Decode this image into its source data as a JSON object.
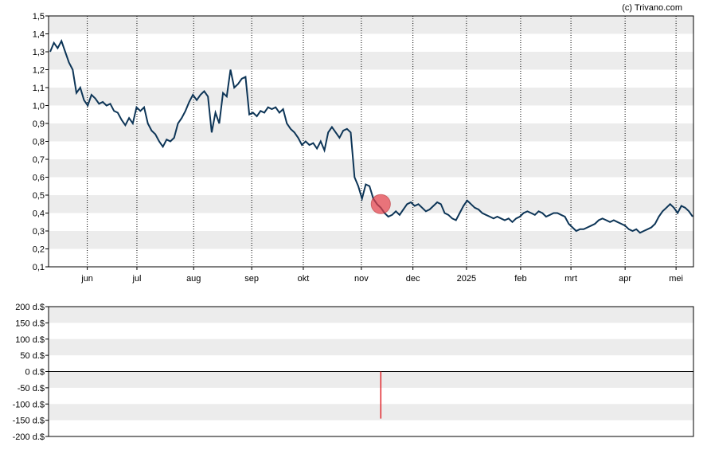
{
  "copyright": "(c) Trivano.com",
  "colors": {
    "price_line": "#0d3557",
    "band": "#ececec",
    "marker": "#e8414a",
    "bar": "#e0242b"
  },
  "chart_data": [
    {
      "type": "line",
      "ylim": [
        0.1,
        1.5
      ],
      "yticks": [
        "0,1",
        "0,2",
        "0,3",
        "0,4",
        "0,5",
        "0,6",
        "0,7",
        "0,8",
        "0,9",
        "1,0",
        "1,1",
        "1,2",
        "1,3",
        "1,4",
        "1,5"
      ],
      "xticks": [
        "jun",
        "jul",
        "aug",
        "sep",
        "okt",
        "nov",
        "dec",
        "2025",
        "feb",
        "mrt",
        "apr",
        "mei"
      ],
      "grid": true,
      "series": [
        {
          "values": [
            1.3,
            1.35,
            1.32,
            1.36,
            1.3,
            1.24,
            1.2,
            1.07,
            1.1,
            1.03,
            1.0,
            1.06,
            1.04,
            1.01,
            1.02,
            1.0,
            1.01,
            0.97,
            0.96,
            0.92,
            0.89,
            0.93,
            0.9,
            0.99,
            0.97,
            0.99,
            0.9,
            0.86,
            0.84,
            0.8,
            0.77,
            0.81,
            0.8,
            0.82,
            0.9,
            0.93,
            0.97,
            1.02,
            1.06,
            1.03,
            1.06,
            1.08,
            1.05,
            0.85,
            0.96,
            0.9,
            1.07,
            1.05,
            1.2,
            1.1,
            1.12,
            1.15,
            1.16,
            0.95,
            0.96,
            0.94,
            0.97,
            0.96,
            0.99,
            0.98,
            0.99,
            0.96,
            0.98,
            0.9,
            0.87,
            0.85,
            0.82,
            0.78,
            0.8,
            0.78,
            0.79,
            0.76,
            0.8,
            0.75,
            0.85,
            0.88,
            0.85,
            0.82,
            0.86,
            0.87,
            0.85,
            0.6,
            0.55,
            0.48,
            0.56,
            0.55,
            0.48,
            0.45,
            0.43,
            0.4,
            0.38,
            0.39,
            0.41,
            0.39,
            0.42,
            0.45,
            0.46,
            0.44,
            0.45,
            0.43,
            0.41,
            0.42,
            0.44,
            0.46,
            0.45,
            0.4,
            0.39,
            0.37,
            0.36,
            0.4,
            0.44,
            0.47,
            0.45,
            0.43,
            0.42,
            0.4,
            0.39,
            0.38,
            0.37,
            0.38,
            0.37,
            0.36,
            0.37,
            0.35,
            0.37,
            0.38,
            0.4,
            0.41,
            0.4,
            0.39,
            0.41,
            0.4,
            0.38,
            0.39,
            0.4,
            0.4,
            0.39,
            0.38,
            0.34,
            0.32,
            0.3,
            0.31,
            0.31,
            0.32,
            0.33,
            0.34,
            0.36,
            0.37,
            0.36,
            0.35,
            0.36,
            0.35,
            0.34,
            0.33,
            0.31,
            0.3,
            0.31,
            0.29,
            0.3,
            0.31,
            0.32,
            0.34,
            0.38,
            0.41,
            0.43,
            0.45,
            0.43,
            0.4,
            0.44,
            0.43,
            0.41,
            0.38
          ]
        }
      ],
      "marker": {
        "index": 88,
        "value": 0.45
      }
    },
    {
      "type": "bar",
      "ylim": [
        -200,
        200
      ],
      "yticks": [
        "-200 d.$",
        "-150 d.$",
        "-100 d.$",
        "-50 d.$",
        "0 d.$",
        "50 d.$",
        "100 d.$",
        "150 d.$",
        "200 d.$"
      ],
      "grid": true,
      "bars": [
        {
          "index": 88,
          "value": -145
        }
      ]
    }
  ]
}
